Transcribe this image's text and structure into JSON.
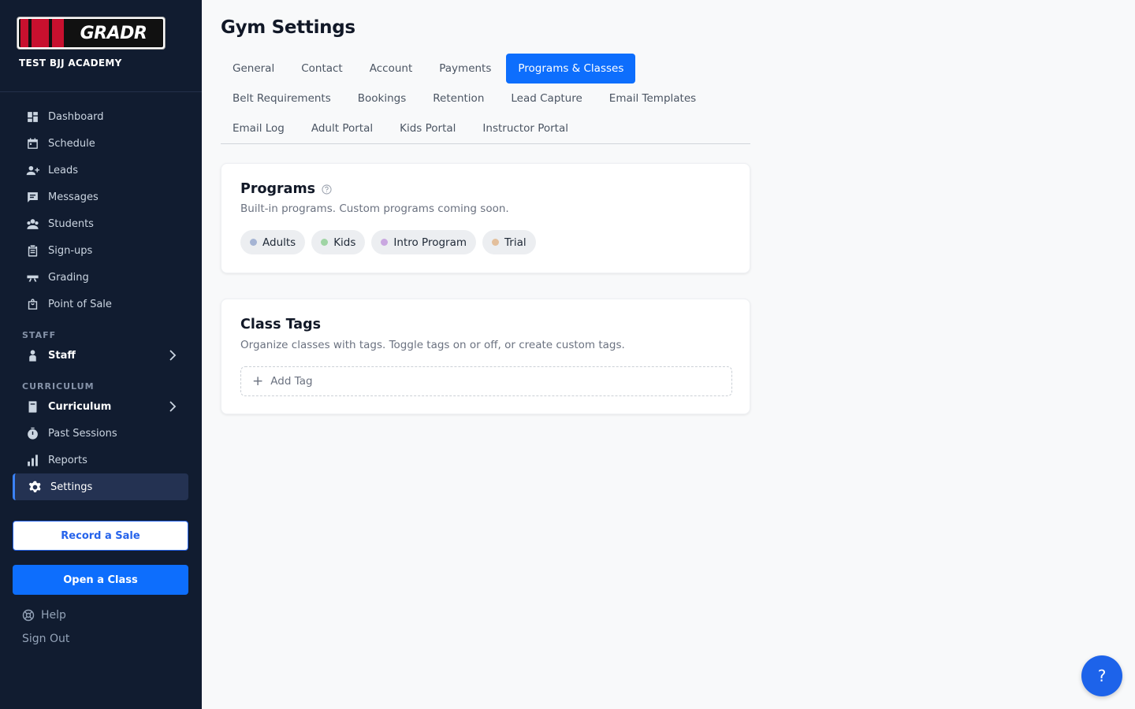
{
  "brand": {
    "logo_text": "GRADR",
    "academy": "TEST BJJ ACADEMY"
  },
  "sidebar": {
    "items": [
      {
        "label": "Dashboard",
        "icon": "dashboard-icon"
      },
      {
        "label": "Schedule",
        "icon": "calendar-icon"
      },
      {
        "label": "Leads",
        "icon": "person-add-icon"
      },
      {
        "label": "Messages",
        "icon": "message-icon"
      },
      {
        "label": "Students",
        "icon": "students-icon"
      },
      {
        "label": "Sign-ups",
        "icon": "clipboard-icon"
      },
      {
        "label": "Grading",
        "icon": "belt-icon"
      },
      {
        "label": "Point of Sale",
        "icon": "shopping-bag-icon"
      }
    ],
    "staff_section": "STAFF",
    "staff_label": "Staff",
    "curriculum_section": "CURRICULUM",
    "curriculum_label": "Curriculum",
    "past_sessions": "Past Sessions",
    "reports": "Reports",
    "settings": "Settings",
    "record_sale": "Record a Sale",
    "open_class": "Open a Class",
    "help": "Help",
    "sign_out": "Sign Out"
  },
  "page": {
    "title": "Gym Settings",
    "tabs_row1": [
      "General",
      "Contact",
      "Account",
      "Payments",
      "Programs & Classes"
    ],
    "tabs_row2": [
      "Belt Requirements",
      "Bookings",
      "Retention",
      "Lead Capture",
      "Email Templates"
    ],
    "tabs_row3": [
      "Email Log",
      "Adult Portal",
      "Kids Portal",
      "Instructor Portal"
    ],
    "active_tab": "Programs & Classes"
  },
  "programs": {
    "title": "Programs",
    "description": "Built-in programs. Custom programs coming soon.",
    "chips": [
      {
        "label": "Adults",
        "color": "#a5b4d4"
      },
      {
        "label": "Kids",
        "color": "#9fd4a4"
      },
      {
        "label": "Intro Program",
        "color": "#c9a7e0"
      },
      {
        "label": "Trial",
        "color": "#e3bf9c"
      }
    ]
  },
  "class_tags": {
    "title": "Class Tags",
    "description": "Organize classes with tags. Toggle tags on or off, or create custom tags.",
    "add_label": "Add Tag"
  },
  "fab": {
    "label": "?"
  },
  "colors": {
    "sidebar_bg": "#111c30",
    "accent": "#0d6efd"
  }
}
